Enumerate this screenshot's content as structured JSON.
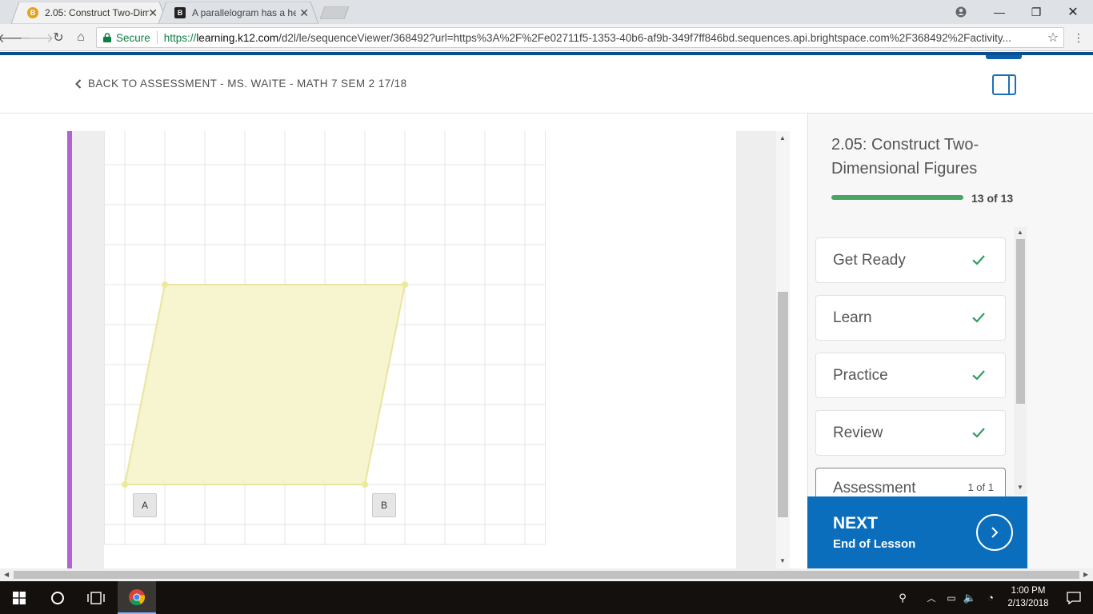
{
  "browser": {
    "tabs": [
      {
        "title": "2.05: Construct Two-Dim",
        "favicon": "B",
        "active": true
      },
      {
        "title": "A parallelogram has a he",
        "favicon": "B",
        "active": false
      }
    ],
    "secure_label": "Secure",
    "url_scheme": "https://",
    "url_host": "learning.k12.com",
    "url_rest": "/d2l/le/sequenceViewer/368492?url=https%3A%2F%2Fe02711f5-1353-40b6-af9b-349f7ff846bd.sequences.api.brightspace.com%2F368492%2Factivity..."
  },
  "header": {
    "back_link": "BACK TO ASSESSMENT - MS. WAITE - MATH 7 SEM 2 17/18"
  },
  "figure": {
    "grid_color": "#e6e6e6",
    "shape_fill": "#f6f5cf",
    "shape_stroke": "#e8e5a0",
    "point_labels": [
      "A",
      "B"
    ]
  },
  "sidebar": {
    "lesson_title": "2.05: Construct Two-Dimensional Figures",
    "progress_text": "13 of 13",
    "progress_fraction": 1.0,
    "steps": [
      {
        "label": "Get Ready",
        "done": true
      },
      {
        "label": "Learn",
        "done": true
      },
      {
        "label": "Practice",
        "done": true
      },
      {
        "label": "Review",
        "done": true
      },
      {
        "label": "Assessment",
        "count": "1 of 1"
      }
    ],
    "next_title": "NEXT",
    "next_subtitle": "End of Lesson",
    "accent_color": "#0a6ebd",
    "check_color": "#2e9e5b"
  },
  "taskbar": {
    "time": "1:00 PM",
    "date": "2/13/2018"
  }
}
